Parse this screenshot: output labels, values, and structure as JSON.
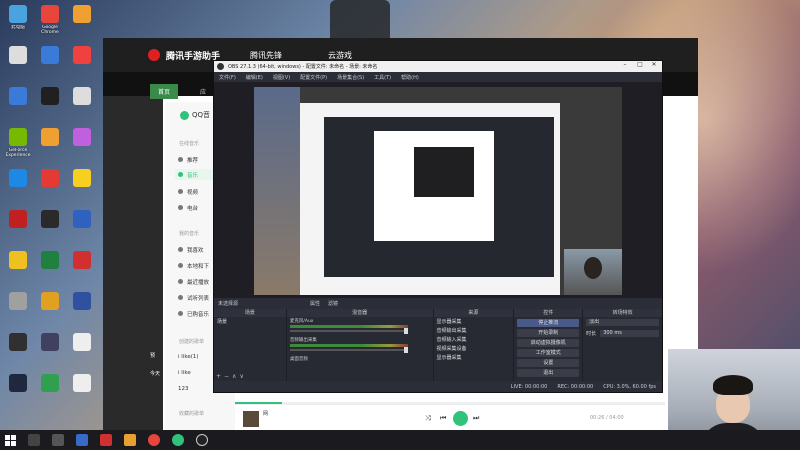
{
  "desktop_icons": [
    {
      "label": "此电脑",
      "color": "#4aa3df"
    },
    {
      "label": "Google Chrome",
      "color": "#e8453c"
    },
    {
      "label": "",
      "color": "#f0a030"
    },
    {
      "label": "",
      "color": "#dddddd"
    },
    {
      "label": "",
      "color": "#3a7ad8"
    },
    {
      "label": "",
      "color": "#f04040"
    },
    {
      "label": "",
      "color": "#3a7ad8"
    },
    {
      "label": "",
      "color": "#202020"
    },
    {
      "label": "",
      "color": "#dddddd"
    },
    {
      "label": "GeForce Experience",
      "color": "#76b900"
    },
    {
      "label": "",
      "color": "#f0a030"
    },
    {
      "label": "",
      "color": "#c060e0"
    },
    {
      "label": "",
      "color": "#1e88e5"
    },
    {
      "label": "",
      "color": "#e53935"
    },
    {
      "label": "",
      "color": "#f5d020"
    },
    {
      "label": "",
      "color": "#c02020"
    },
    {
      "label": "",
      "color": "#2a2a2a"
    },
    {
      "label": "",
      "color": "#3060c0"
    },
    {
      "label": "",
      "color": "#f0c020"
    },
    {
      "label": "",
      "color": "#208040"
    },
    {
      "label": "",
      "color": "#d03030"
    },
    {
      "label": "",
      "color": "#a0a0a0"
    },
    {
      "label": "",
      "color": "#e0a020"
    },
    {
      "label": "",
      "color": "#3050a0"
    },
    {
      "label": "",
      "color": "#303030"
    },
    {
      "label": "",
      "color": "#404060"
    },
    {
      "label": "",
      "color": "#eeeeee"
    },
    {
      "label": "",
      "color": "#202840"
    },
    {
      "label": "",
      "color": "#30a050"
    },
    {
      "label": "",
      "color": "#eeeeee"
    }
  ],
  "tencent": {
    "brand": "腾讯手游助手",
    "tab2": "腾讯先锋",
    "tab3": "云游戏",
    "tab_home": "首页",
    "tab_other": "应",
    "accent": "#3a8a4a"
  },
  "qq": {
    "logo": "QQ音",
    "sections": [
      "在线音乐",
      "我的音乐",
      "创建的歌单",
      "收藏的歌单"
    ],
    "online": [
      "推荐",
      "音乐",
      "视频",
      "电台"
    ],
    "mine": [
      "我喜欢",
      "本地和下",
      "最近播放",
      "试听列表",
      "已购音乐"
    ],
    "playlists": [
      "i like(1)",
      "i like",
      "123"
    ],
    "song": "网",
    "time": "00:26 / 04:00",
    "progress": 0.11,
    "accent": "#31c27c"
  },
  "side_texts": {
    "a": "预",
    "b": "今天"
  },
  "obs": {
    "title": "OBS 27.1.3 (64-bit, windows) - 配置文件: 未命名 - 场景: 未命名",
    "menu": [
      "文件(F)",
      "编辑(E)",
      "视图(V)",
      "配置文件(P)",
      "场景集合(S)",
      "工具(T)",
      "帮助(H)"
    ],
    "source_bar": [
      "未选择源",
      "属性",
      "滤镜"
    ],
    "docks": {
      "scenes": {
        "header": "场景",
        "items": [
          "场景"
        ]
      },
      "sources": {
        "header": "来源",
        "items": [
          "显示器采集",
          "音频输出采集",
          "音频输入采集",
          "视频采集设备",
          "显示器采集"
        ]
      },
      "mixer": {
        "header": "混音器",
        "items": [
          "桌面音频",
          "麦克风/Aux",
          "音频输出采集"
        ]
      },
      "transitions": {
        "header": "转场特效",
        "type": "淡出",
        "duration_label": "时长",
        "duration": "300 ms"
      },
      "controls": {
        "header": "控件",
        "buttons": [
          "停止推流",
          "开始录制",
          "启动虚拟摄像机",
          "工作室模式",
          "设置",
          "退出"
        ]
      }
    },
    "status": [
      "LIVE: 00:00:00",
      "REC: 00:00:00",
      "CPU: 3.0%, 60.00 fps"
    ]
  }
}
